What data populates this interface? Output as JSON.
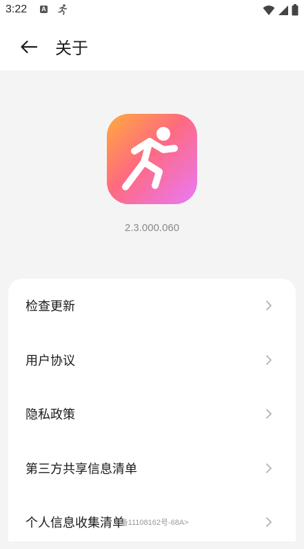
{
  "status_bar": {
    "time": "3:22",
    "notification_a_label": "A",
    "icons": [
      "text-notification-icon",
      "running-icon",
      "wifi-icon",
      "signal-icon",
      "battery-icon"
    ]
  },
  "header": {
    "title": "关于",
    "back_icon": "arrow-left-icon"
  },
  "app": {
    "icon": "running-man-icon",
    "version": "2.3.000.060"
  },
  "menu": {
    "items": [
      {
        "label": "检查更新"
      },
      {
        "label": "用户协议"
      },
      {
        "label": "隐私政策"
      },
      {
        "label": "第三方共享信息清单"
      },
      {
        "label": "个人信息收集清单"
      }
    ]
  },
  "footer": {
    "icp": "P备11108162号-68A>"
  },
  "colors": {
    "icon_gradient_start": "#ffab3d",
    "icon_gradient_mid": "#ff6a7f",
    "icon_gradient_end": "#e879f9",
    "background": "#f4f4f4",
    "card": "#ffffff"
  }
}
